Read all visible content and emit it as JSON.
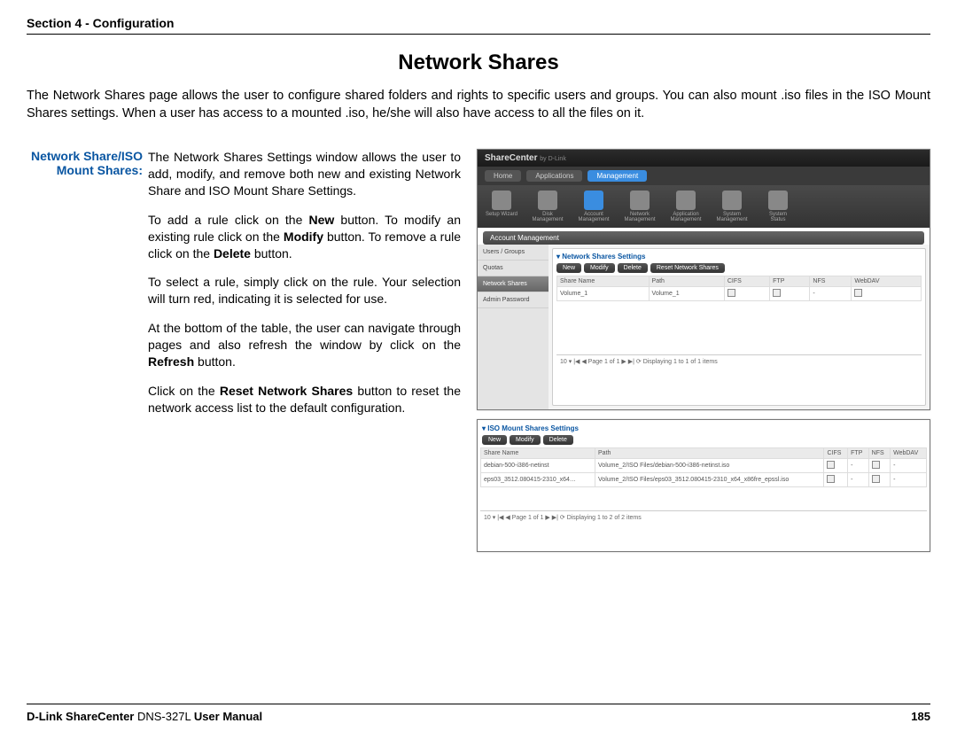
{
  "header": {
    "section": "Section 4 - Configuration"
  },
  "title": "Network Shares",
  "intro": "The Network Shares page allows the user to configure shared folders and rights to specific users and groups. You can also mount .iso files in the ISO Mount Shares settings. When a user has access to a mounted .iso, he/she will also have access to all the files on it.",
  "left": {
    "label1": "Network Share/ISO",
    "label2": "Mount Shares:",
    "p1": "The Network Shares Settings window allows the user to add, modify, and remove both new and existing Network Share and ISO Mount Share Settings.",
    "p2a": "To add a rule click on the ",
    "p2b": "New",
    "p2c": " button. To modify an existing rule click on the ",
    "p2d": "Modify",
    "p2e": " button. To remove a rule click on the ",
    "p2f": "Delete",
    "p2g": " button.",
    "p3": "To select a rule, simply click on the rule. Your selection will turn red, indicating it is selected for use.",
    "p4a": "At the bottom of the table, the user can navigate through pages and also refresh the window by click on the ",
    "p4b": "Refresh",
    "p4c": " button.",
    "p5a": "Click on the ",
    "p5b": "Reset Network Shares",
    "p5c": " button to reset the network access list to the default configuration."
  },
  "ui1": {
    "brand": "ShareCenter",
    "brand_sub": "by D-Link",
    "tabs": [
      "Home",
      "Applications",
      "Management"
    ],
    "icons": [
      "Setup Wizard",
      "Disk Management",
      "Account Management",
      "Network Management",
      "Application Management",
      "System Management",
      "System Status"
    ],
    "bar": "Account Management",
    "sidebar": [
      "Users / Groups",
      "Quotas",
      "Network Shares",
      "Admin Password"
    ],
    "panel_title": "Network Shares Settings",
    "buttons": [
      "New",
      "Modify",
      "Delete",
      "Reset Network Shares"
    ],
    "cols": [
      "Share Name",
      "Path",
      "CIFS",
      "FTP",
      "NFS",
      "WebDAV"
    ],
    "row": {
      "name": "Volume_1",
      "path": "Volume_1"
    },
    "pager": "10 ▾  |◀ ◀  Page 1 of 1  ▶ ▶|  ⟳   Displaying 1 to 1 of 1 items"
  },
  "ui2": {
    "panel_title": "ISO Mount Shares Settings",
    "buttons": [
      "New",
      "Modify",
      "Delete"
    ],
    "cols": [
      "Share Name",
      "Path",
      "CIFS",
      "FTP",
      "NFS",
      "WebDAV"
    ],
    "rows": [
      {
        "name": "debian-500-i386-netinst",
        "path": "Volume_2/ISO Files/debian-500-i386-netinst.iso"
      },
      {
        "name": "eps03_3512.080415-2310_x64…",
        "path": "Volume_2/ISO Files/eps03_3512.080415-2310_x64_x86fre_epssl.iso"
      }
    ],
    "pager": "10 ▾  |◀ ◀  Page 1 of 1  ▶ ▶|  ⟳   Displaying 1 to 2 of 2 items"
  },
  "footer": {
    "left_bold1": "D-Link ShareCenter ",
    "left_reg": "DNS-327L ",
    "left_bold2": "User Manual",
    "page": "185"
  }
}
